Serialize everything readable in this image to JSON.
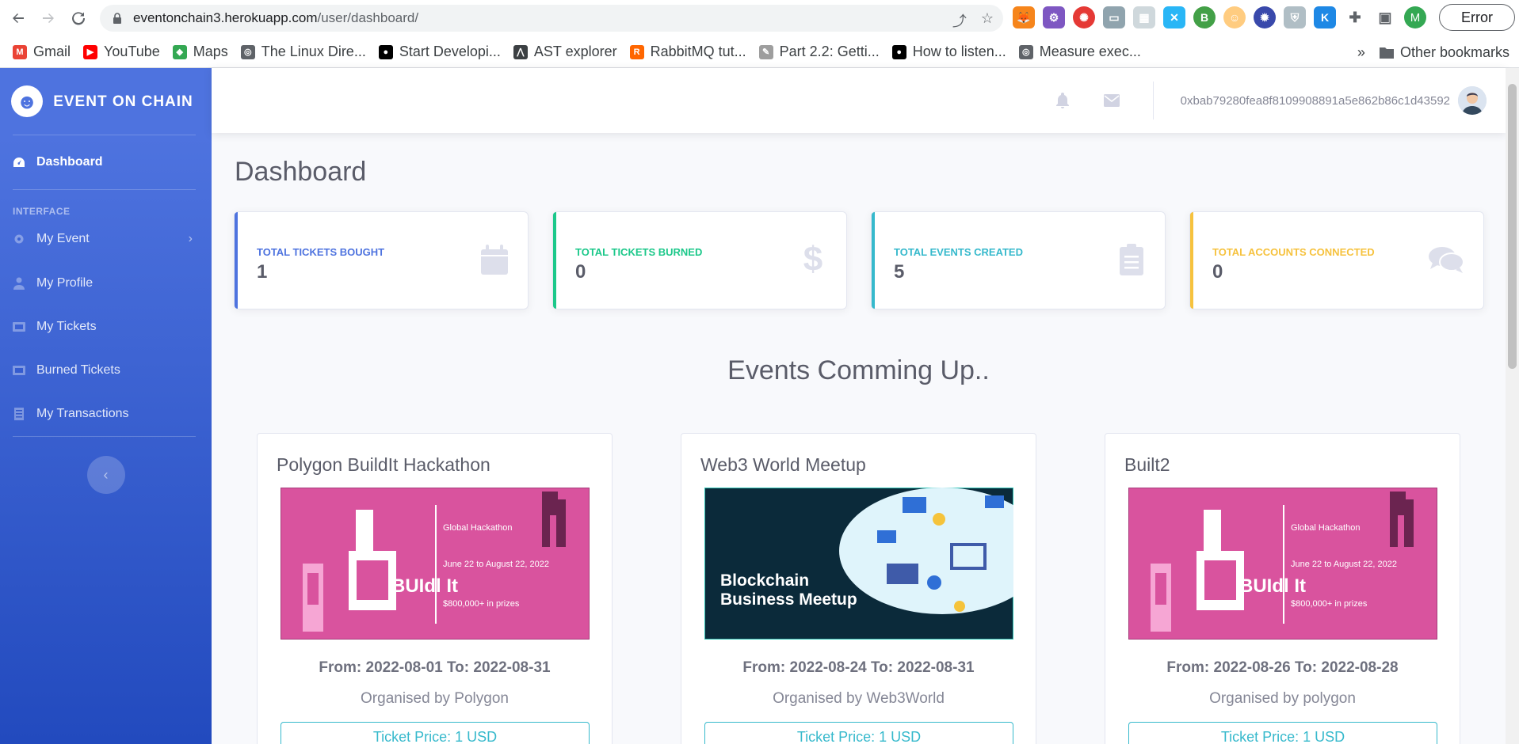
{
  "browser": {
    "url_domain": "eventonchain3.herokuapp.com",
    "url_path": "/user/dashboard/",
    "profile_initial": "M",
    "error_label": "Error",
    "bookmarks": [
      {
        "label": "Gmail",
        "color": "#ea4335",
        "glyph": "M"
      },
      {
        "label": "YouTube",
        "color": "#ff0000",
        "glyph": "▶"
      },
      {
        "label": "Maps",
        "color": "#34a853",
        "glyph": "◆"
      },
      {
        "label": "The Linux Dire...",
        "color": "#5f6368",
        "glyph": "◎"
      },
      {
        "label": "Start Developi...",
        "color": "#000000",
        "glyph": "●"
      },
      {
        "label": "AST explorer",
        "color": "#3c4043",
        "glyph": "⋀"
      },
      {
        "label": "RabbitMQ tut...",
        "color": "#ff6600",
        "glyph": "R"
      },
      {
        "label": "Part 2.2: Getti...",
        "color": "#9e9e9e",
        "glyph": "✎"
      },
      {
        "label": "How to listen...",
        "color": "#000000",
        "glyph": "●"
      },
      {
        "label": "Measure exec...",
        "color": "#5f6368",
        "glyph": "◎"
      }
    ],
    "bookmarks_overflow": "»",
    "other_bookmarks": "Other bookmarks"
  },
  "sidebar": {
    "brand": "EVENT ON CHAIN",
    "dashboard": "Dashboard",
    "heading": "INTERFACE",
    "items": [
      {
        "label": "My Event",
        "icon": "gear-icon"
      },
      {
        "label": "My Profile",
        "icon": "user-icon"
      },
      {
        "label": "My Tickets",
        "icon": "ticket-icon"
      },
      {
        "label": "Burned Tickets",
        "icon": "ticket-icon"
      },
      {
        "label": "My Transactions",
        "icon": "receipt-icon"
      }
    ]
  },
  "topbar": {
    "wallet_address": "0xbab79280fea8f8109908891a5e862b86c1d43592"
  },
  "page": {
    "title": "Dashboard",
    "section_title": "Events Comming Up.."
  },
  "stats": [
    {
      "label": "TOTAL TICKETS BOUGHT",
      "value": "1",
      "color": "#4e73df",
      "icon": "calendar-icon"
    },
    {
      "label": "TOTAL TICKETS BURNED",
      "value": "0",
      "color": "#1cc88a",
      "icon": "dollar-icon"
    },
    {
      "label": "TOTAL EVENTS CREATED",
      "value": "5",
      "color": "#36b9cc",
      "icon": "clipboard-icon"
    },
    {
      "label": "TOTAL ACCOUNTS CONNECTED",
      "value": "0",
      "color": "#f6c23e",
      "icon": "comments-icon"
    }
  ],
  "events": [
    {
      "title": "Polygon BuildIt Hackathon",
      "dates": "From: 2022-08-01 To: 2022-08-31",
      "organiser": "Organised by Polygon",
      "price": "Ticket Price: 1 USD",
      "banner": {
        "brand": "BUIdl It",
        "line1": "Global Hackathon",
        "line2": "June 22 to August 22, 2022",
        "line3": "$800,000+ in prizes"
      }
    },
    {
      "title": "Web3 World Meetup",
      "dates": "From: 2022-08-24 To: 2022-08-31",
      "organiser": "Organised by Web3World",
      "price": "Ticket Price: 1 USD",
      "banner": {
        "line1": "Blockchain",
        "line2": "Business Meetup"
      }
    },
    {
      "title": "Built2",
      "dates": "From: 2022-08-26 To: 2022-08-28",
      "organiser": "Organised by polygon",
      "price": "Ticket Price: 1 USD",
      "banner": {
        "brand": "BUIdl It",
        "line1": "Global Hackathon",
        "line2": "June 22 to August 22, 2022",
        "line3": "$800,000+ in prizes"
      }
    }
  ]
}
